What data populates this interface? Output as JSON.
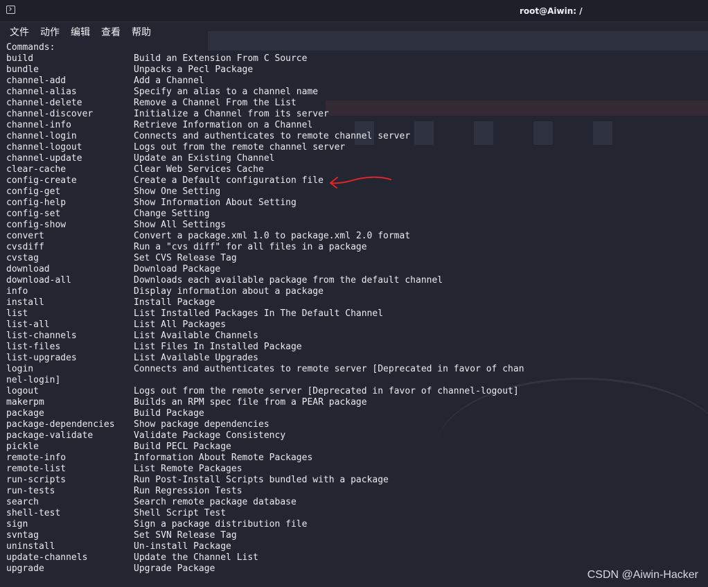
{
  "window": {
    "title": "root@Aiwin: /"
  },
  "menubar": {
    "items": [
      "文件",
      "动作",
      "编辑",
      "查看",
      "帮助"
    ]
  },
  "terminal": {
    "header": "Commands:",
    "commands": [
      {
        "name": "build",
        "desc": "Build an Extension From C Source"
      },
      {
        "name": "bundle",
        "desc": "Unpacks a Pecl Package"
      },
      {
        "name": "channel-add",
        "desc": "Add a Channel"
      },
      {
        "name": "channel-alias",
        "desc": "Specify an alias to a channel name"
      },
      {
        "name": "channel-delete",
        "desc": "Remove a Channel From the List"
      },
      {
        "name": "channel-discover",
        "desc": "Initialize a Channel from its server"
      },
      {
        "name": "channel-info",
        "desc": "Retrieve Information on a Channel"
      },
      {
        "name": "channel-login",
        "desc": "Connects and authenticates to remote channel server"
      },
      {
        "name": "channel-logout",
        "desc": "Logs out from the remote channel server"
      },
      {
        "name": "channel-update",
        "desc": "Update an Existing Channel"
      },
      {
        "name": "clear-cache",
        "desc": "Clear Web Services Cache"
      },
      {
        "name": "config-create",
        "desc": "Create a Default configuration file"
      },
      {
        "name": "config-get",
        "desc": "Show One Setting"
      },
      {
        "name": "config-help",
        "desc": "Show Information About Setting"
      },
      {
        "name": "config-set",
        "desc": "Change Setting"
      },
      {
        "name": "config-show",
        "desc": "Show All Settings"
      },
      {
        "name": "convert",
        "desc": "Convert a package.xml 1.0 to package.xml 2.0 format"
      },
      {
        "name": "cvsdiff",
        "desc": "Run a \"cvs diff\" for all files in a package"
      },
      {
        "name": "cvstag",
        "desc": "Set CVS Release Tag"
      },
      {
        "name": "download",
        "desc": "Download Package"
      },
      {
        "name": "download-all",
        "desc": "Downloads each available package from the default channel"
      },
      {
        "name": "info",
        "desc": "Display information about a package"
      },
      {
        "name": "install",
        "desc": "Install Package"
      },
      {
        "name": "list",
        "desc": "List Installed Packages In The Default Channel"
      },
      {
        "name": "list-all",
        "desc": "List All Packages"
      },
      {
        "name": "list-channels",
        "desc": "List Available Channels"
      },
      {
        "name": "list-files",
        "desc": "List Files In Installed Package"
      },
      {
        "name": "list-upgrades",
        "desc": "List Available Upgrades"
      },
      {
        "name": "login",
        "desc": "Connects and authenticates to remote server [Deprecated in favor of chan"
      },
      {
        "name": "nel-login]",
        "desc": ""
      },
      {
        "name": "logout",
        "desc": "Logs out from the remote server [Deprecated in favor of channel-logout]"
      },
      {
        "name": "makerpm",
        "desc": "Builds an RPM spec file from a PEAR package"
      },
      {
        "name": "package",
        "desc": "Build Package"
      },
      {
        "name": "package-dependencies",
        "desc": "Show package dependencies"
      },
      {
        "name": "package-validate",
        "desc": "Validate Package Consistency"
      },
      {
        "name": "pickle",
        "desc": "Build PECL Package"
      },
      {
        "name": "remote-info",
        "desc": "Information About Remote Packages"
      },
      {
        "name": "remote-list",
        "desc": "List Remote Packages"
      },
      {
        "name": "run-scripts",
        "desc": "Run Post-Install Scripts bundled with a package"
      },
      {
        "name": "run-tests",
        "desc": "Run Regression Tests"
      },
      {
        "name": "search",
        "desc": "Search remote package database"
      },
      {
        "name": "shell-test",
        "desc": "Shell Script Test"
      },
      {
        "name": "sign",
        "desc": "Sign a package distribution file"
      },
      {
        "name": "svntag",
        "desc": "Set SVN Release Tag"
      },
      {
        "name": "uninstall",
        "desc": "Un-install Package"
      },
      {
        "name": "update-channels",
        "desc": "Update the Channel List"
      },
      {
        "name": "upgrade",
        "desc": "Upgrade Package"
      }
    ]
  },
  "annotation": {
    "icon": "red-arrow-icon",
    "color": "#e0242a"
  },
  "watermark": "CSDN @Aiwin-Hacker"
}
